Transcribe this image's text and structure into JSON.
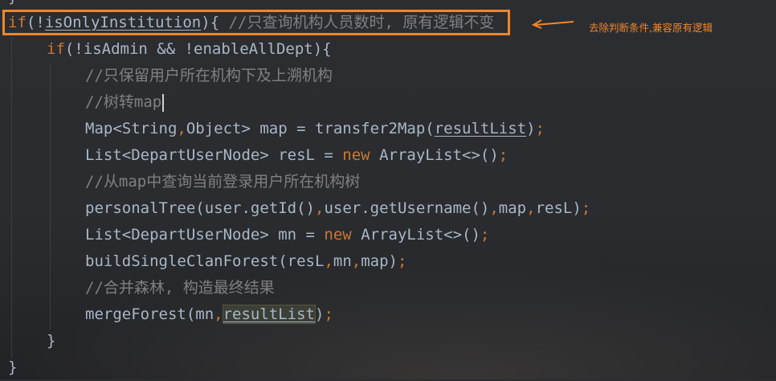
{
  "editor": {
    "lines": [
      {
        "id": "brace-top",
        "text": "}"
      },
      {
        "id": "if-institution"
      },
      {
        "id": "if-admin"
      },
      {
        "id": "comment-1",
        "text": "//只保留用户所在机构下及上溯机构"
      },
      {
        "id": "comment-2",
        "text": "//树转map"
      },
      {
        "id": "map-decl"
      },
      {
        "id": "list-resl"
      },
      {
        "id": "comment-3",
        "text": "//从map中查询当前登录用户所在机构树"
      },
      {
        "id": "personal-tree"
      },
      {
        "id": "list-mn"
      },
      {
        "id": "build-forest"
      },
      {
        "id": "comment-4",
        "text": "//合并森林, 构造最终结果"
      },
      {
        "id": "merge-forest"
      },
      {
        "id": "close-inner",
        "text": "}"
      },
      {
        "id": "close-outer",
        "text": "}"
      }
    ],
    "tokens": {
      "if_kw": "if",
      "not_is_only": "(!",
      "is_only_institution": "isOnlyInstitution",
      "close_brace_open": "){",
      "comment_only": " //只查询机构人员数时, 原有逻辑不变",
      "is_admin_expr": "(!isAdmin && !enableAllDept){",
      "map_decl_a": "Map<String",
      "comma": ",",
      "map_decl_b": "Object> map = transfer2Map(",
      "result_list": "resultList",
      "rparen": ")",
      "semi": ";",
      "list_resl_a": "List<DepartUserNode> resL = ",
      "new_kw": "new",
      "array_list": " ArrayList<>()",
      "personal_a": "personalTree(user.getId()",
      "personal_b": "user.getUsername()",
      "personal_c": "map",
      "personal_d": "resL)",
      "list_mn_a": "List<DepartUserNode> mn = ",
      "build_a": "buildSingleClanForest(resL",
      "build_b": "mn",
      "build_c": "map)",
      "merge_a": "mergeForest(mn",
      "merge_b": "resultList",
      "merge_c": ")"
    }
  },
  "annotation": {
    "text": "去除判断条件,兼容原有逻辑",
    "color": "#f0862a"
  }
}
